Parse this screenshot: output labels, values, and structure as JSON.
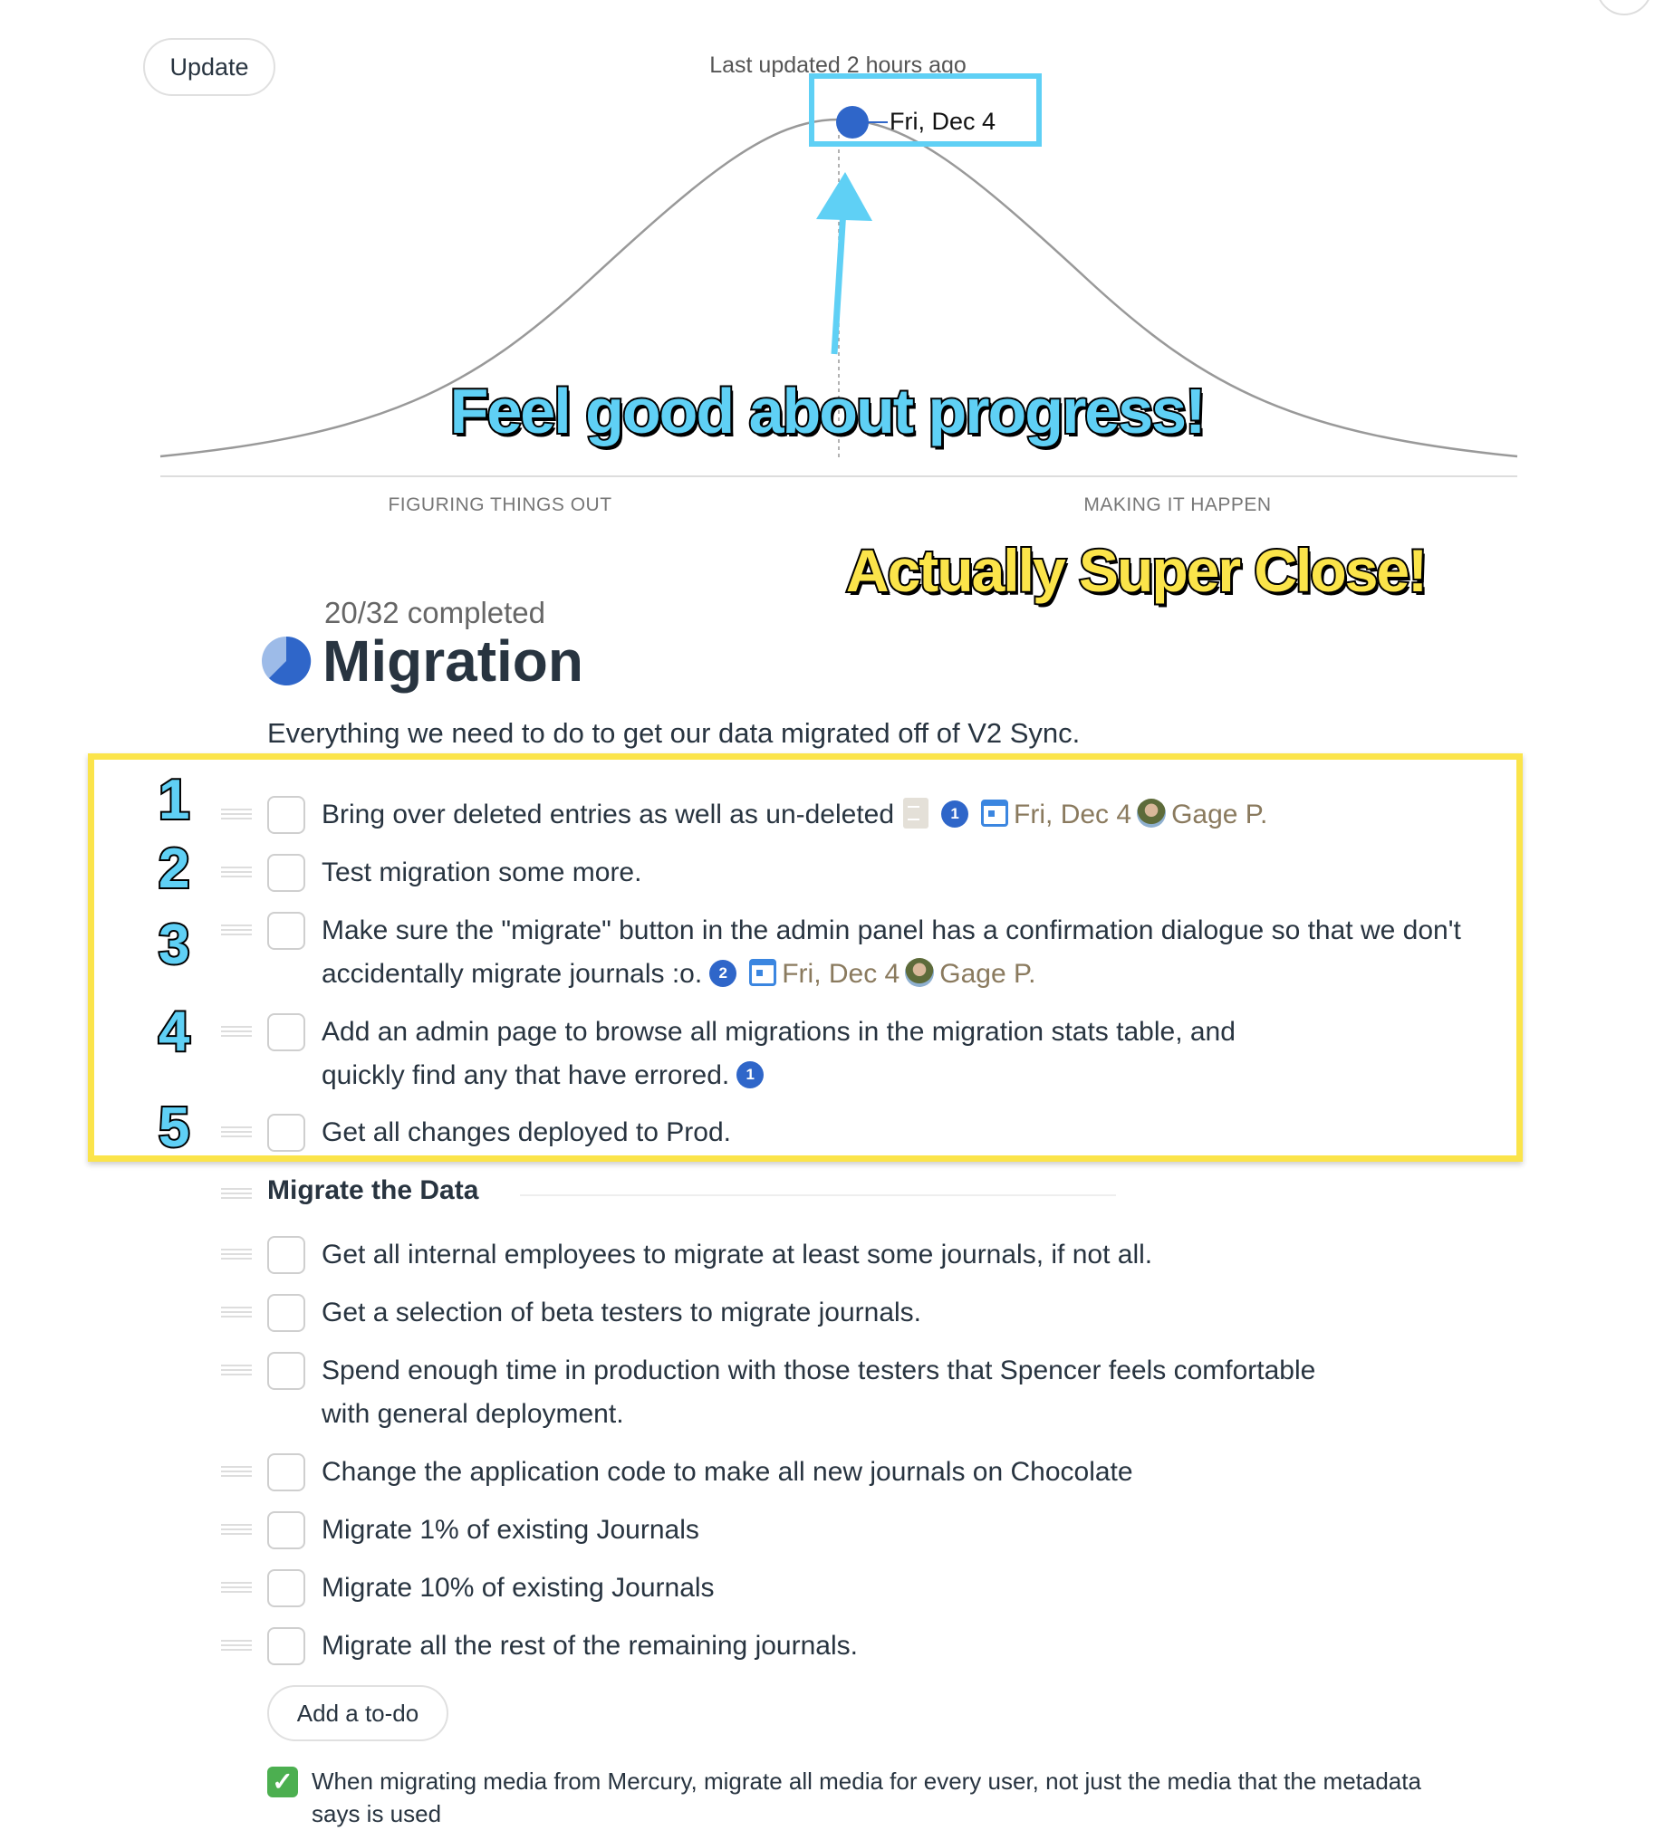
{
  "header": {
    "update_label": "Update",
    "last_updated": "Last updated 2 hours ago"
  },
  "hill_chart": {
    "point_label": "Fri, Dec 4",
    "point_color": "#2f66c9",
    "left_label": "FIGURING THINGS OUT",
    "right_label": "MAKING IT HAPPEN",
    "position_fraction": 0.51
  },
  "annotations": {
    "cyan_text": "Feel good about progress!",
    "yellow_text": "Actually Super Close!",
    "numbers": [
      "1",
      "2",
      "3",
      "4",
      "5"
    ],
    "cyan_color": "#5fd0f5",
    "yellow_color": "#fbe44a"
  },
  "list": {
    "completed": "20/32 completed",
    "title": "Migration",
    "description": "Everything we need to do to get our data migrated off of V2 Sync.",
    "progress_fraction": 0.625,
    "items": [
      {
        "text": "Bring over deleted entries as well as un-deleted",
        "comments": "1",
        "due": "Fri, Dec 4",
        "assignee": "Gage P."
      },
      {
        "text": "Test migration some more."
      },
      {
        "text": "Make sure the \"migrate\" button in the admin panel has a confirmation dialogue so that we don't accidentally migrate journals :o.",
        "comments": "2",
        "due": "Fri, Dec 4",
        "assignee": "Gage P."
      },
      {
        "text": "Add an admin page to browse all migrations in the migration stats table, and quickly find any that have errored.",
        "comments": "1"
      },
      {
        "text": "Get all changes deployed to Prod."
      }
    ],
    "group": {
      "title": "Migrate the Data",
      "items": [
        "Get all internal employees to migrate at least some journals, if not all.",
        "Get a selection of beta testers to migrate journals.",
        "Spend enough time in production with those testers that Spencer feels comfortable with general deployment.",
        "Change the application code to make all new journals on Chocolate",
        "Migrate 1% of existing Journals",
        "Migrate 10% of existing Journals",
        "Migrate all the rest of the remaining journals."
      ]
    },
    "add_todo_label": "Add a to-do",
    "done_items": [
      "When migrating media from Mercury, migrate all media for every user, not just the media that the metadata says is used"
    ]
  }
}
